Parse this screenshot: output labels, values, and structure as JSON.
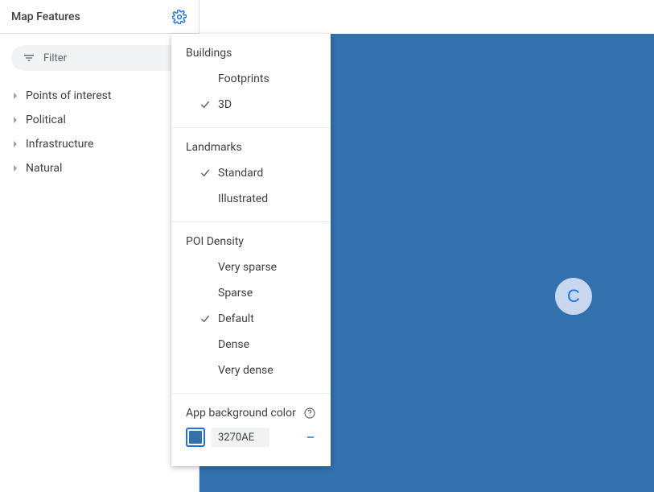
{
  "sidebar": {
    "title": "Map Features",
    "filter_placeholder": "Filter",
    "features": [
      {
        "label": "Points of interest"
      },
      {
        "label": "Political"
      },
      {
        "label": "Infrastructure"
      },
      {
        "label": "Natural"
      }
    ]
  },
  "settings_panel": {
    "sections": [
      {
        "title": "Buildings",
        "options": [
          {
            "label": "Footprints",
            "selected": false
          },
          {
            "label": "3D",
            "selected": true
          }
        ]
      },
      {
        "title": "Landmarks",
        "options": [
          {
            "label": "Standard",
            "selected": true
          },
          {
            "label": "Illustrated",
            "selected": false
          }
        ]
      },
      {
        "title": "POI Density",
        "options": [
          {
            "label": "Very sparse",
            "selected": false
          },
          {
            "label": "Sparse",
            "selected": false
          },
          {
            "label": "Default",
            "selected": true
          },
          {
            "label": "Dense",
            "selected": false
          },
          {
            "label": "Very dense",
            "selected": false
          }
        ]
      }
    ],
    "background_color": {
      "title": "App background color",
      "hex": "3270AE"
    }
  },
  "map": {
    "background_color": "#3270AE"
  },
  "avatar": {
    "initial": "C"
  }
}
